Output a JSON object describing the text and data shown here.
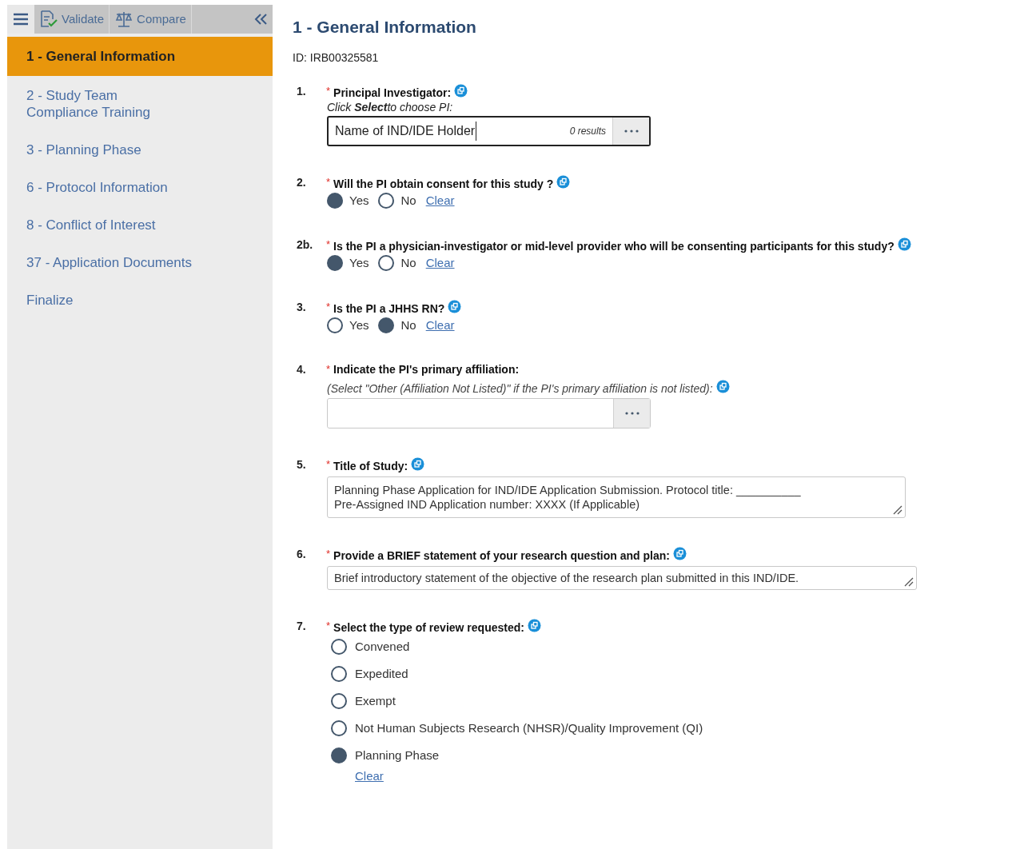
{
  "toolbar": {
    "buttons": [
      {
        "label": "Validate"
      },
      {
        "label": "Compare"
      }
    ]
  },
  "sidebar": {
    "items": [
      {
        "label": "1 - General Information",
        "selected": true
      },
      {
        "label": "2 - Study Team Compliance Training",
        "selected": false
      },
      {
        "label": "3 - Planning Phase",
        "selected": false
      },
      {
        "label": "6 - Protocol Information",
        "selected": false
      },
      {
        "label": "8 - Conflict of Interest",
        "selected": false
      },
      {
        "label": "37 - Application Documents",
        "selected": false
      },
      {
        "label": "Finalize",
        "selected": false
      }
    ]
  },
  "page": {
    "title": "1 - General Information",
    "id_line": "ID: IRB00325581"
  },
  "questions": [
    {
      "number": "1.",
      "kind": "lookup",
      "required_mark": "*",
      "label": "Principal Investigator:",
      "hint": "Click **Select**to choose PI:",
      "value": "Name of IND/IDE Holder",
      "results": "0 results",
      "focused": true
    },
    {
      "number": "2.",
      "kind": "radio_inline",
      "required_mark": "*",
      "label": "Will the PI obtain consent for this study ?",
      "options": [
        {
          "label": "Yes",
          "selected": true
        },
        {
          "label": "No",
          "selected": false
        }
      ],
      "clear": "Clear"
    },
    {
      "number": "2b.",
      "kind": "radio_inline",
      "required_mark": "*",
      "label": "Is the PI a physician-investigator or mid-level provider who will be consenting participants for this study?",
      "options": [
        {
          "label": "Yes",
          "selected": true
        },
        {
          "label": "No",
          "selected": false
        }
      ],
      "clear": "Clear"
    },
    {
      "number": "3.",
      "kind": "radio_inline",
      "required_mark": "*",
      "label": "Is the PI a JHHS RN?",
      "options": [
        {
          "label": "Yes",
          "selected": false
        },
        {
          "label": "No",
          "selected": true
        }
      ],
      "clear": "Clear"
    },
    {
      "number": "4.",
      "kind": "lookup",
      "required_mark": "*",
      "label": "Indicate the PI's primary affiliation:",
      "note": "(Select \"Other (Affiliation Not Listed)\" if the PI's primary affiliation is not listed):",
      "focused": false
    },
    {
      "number": "5.",
      "kind": "textarea",
      "required_mark": "*",
      "label": "Title of Study:",
      "lines": [
        "Planning Phase Application for IND/IDE Application Submission. Protocol title: __________",
        "Pre-Assigned IND Application number: XXXX (If Applicable)"
      ]
    },
    {
      "number": "6.",
      "kind": "textarea",
      "required_mark": "*",
      "label": "Provide a BRIEF statement of your research question and plan:",
      "lines": [
        "Brief introductory statement of the objective of the research plan submitted in this IND/IDE."
      ]
    },
    {
      "number": "7.",
      "kind": "radio_list",
      "required_mark": "*",
      "label": "Select the type of review requested:",
      "options": [
        {
          "label": "Convened",
          "selected": false
        },
        {
          "label": "Expedited",
          "selected": false
        },
        {
          "label": "Exempt",
          "selected": false
        },
        {
          "label": "Not Human Subjects Research (NHSR)/Quality Improvement (QI)",
          "selected": false
        },
        {
          "label": "Planning Phase",
          "selected": true
        }
      ],
      "clear": "Clear"
    }
  ]
}
